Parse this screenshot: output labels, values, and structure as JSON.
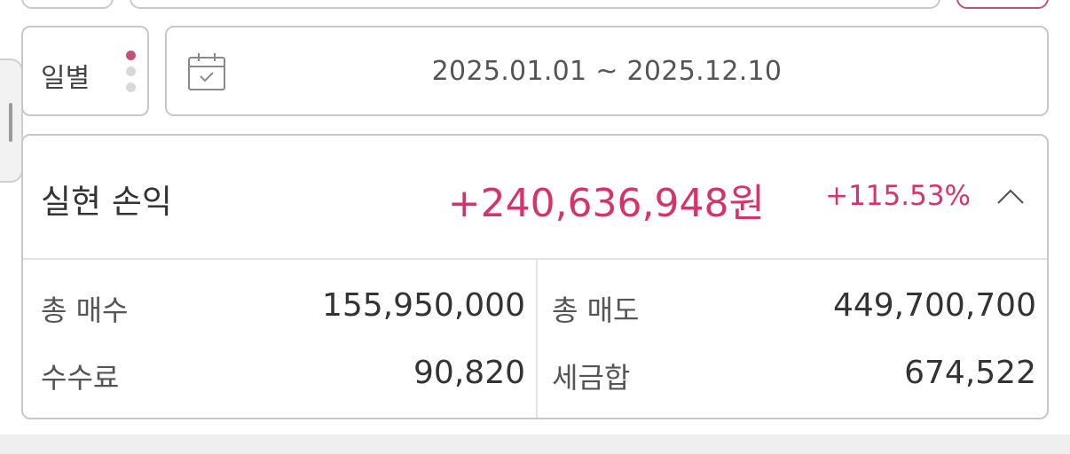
{
  "period": {
    "label": "일별",
    "options_count": 3,
    "selected_index": 0
  },
  "date_range": {
    "text": "2025.01.01 ~ 2025.12.10"
  },
  "realized_pnl": {
    "title": "실현 손익",
    "amount": "+240,636,948원",
    "rate": "+115.53%",
    "expanded": true
  },
  "details": {
    "total_buy_label": "총 매수",
    "total_buy_value": "155,950,000",
    "total_sell_label": "총 매도",
    "total_sell_value": "449,700,700",
    "fee_label": "수수료",
    "fee_value": "90,820",
    "tax_label": "세금합",
    "tax_value": "674,522"
  },
  "colors": {
    "accent": "#d6336c",
    "dot_active": "#c2507a",
    "border": "#c8c8c8"
  },
  "icons": {
    "calendar": "calendar-icon",
    "collapse": "chevron-up-icon"
  }
}
